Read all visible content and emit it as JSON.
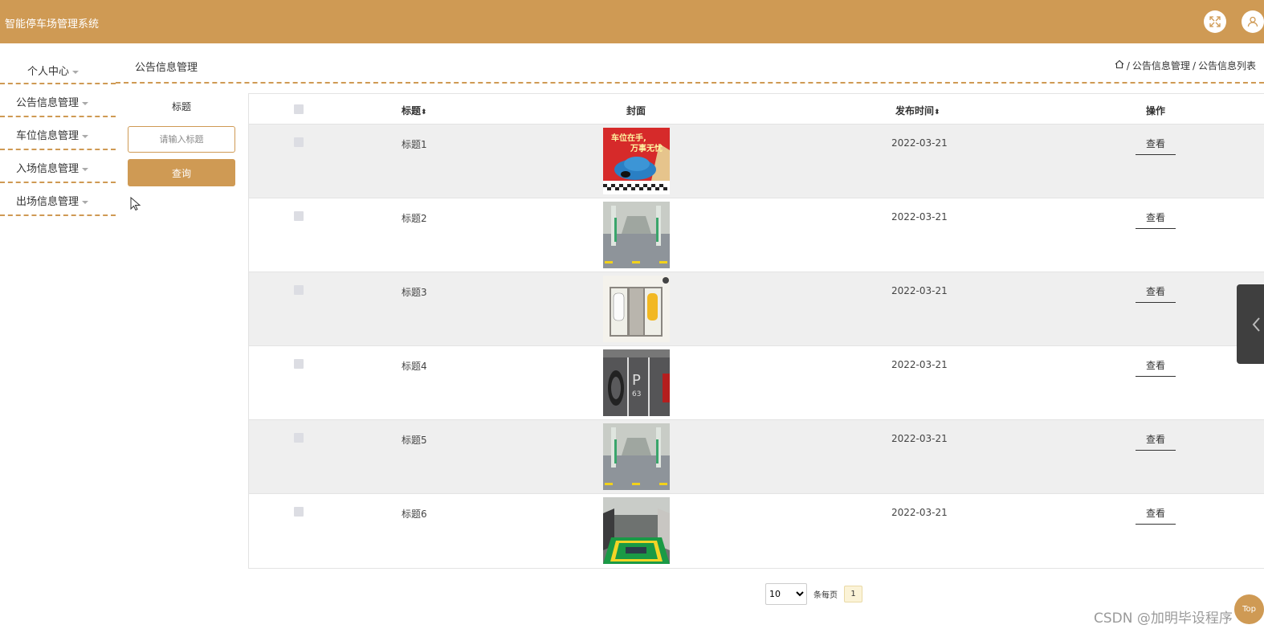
{
  "header": {
    "app_title": "智能停车场管理系统",
    "icons": [
      "fullscreen-icon",
      "user-icon"
    ]
  },
  "sidebar": {
    "items": [
      {
        "label": "个人中心"
      },
      {
        "label": "公告信息管理"
      },
      {
        "label": "车位信息管理"
      },
      {
        "label": "入场信息管理"
      },
      {
        "label": "出场信息管理"
      }
    ]
  },
  "page": {
    "title": "公告信息管理",
    "breadcrumb": [
      "公告信息管理",
      "公告信息列表"
    ]
  },
  "search": {
    "label": "标题",
    "placeholder": "请输入标题",
    "button_label": "查询"
  },
  "table": {
    "headers": {
      "title": "标题",
      "cover": "封面",
      "date": "发布时间",
      "action": "操作"
    },
    "rows": [
      {
        "title": "标题1",
        "date": "2022-03-21",
        "action": "查看"
      },
      {
        "title": "标题2",
        "date": "2022-03-21",
        "action": "查看"
      },
      {
        "title": "标题3",
        "date": "2022-03-21",
        "action": "查看"
      },
      {
        "title": "标题4",
        "date": "2022-03-21",
        "action": "查看"
      },
      {
        "title": "标题5",
        "date": "2022-03-21",
        "action": "查看"
      },
      {
        "title": "标题6",
        "date": "2022-03-21",
        "action": "查看"
      }
    ],
    "cover_1_text": [
      "车位在手,",
      "万事无忧"
    ]
  },
  "pagination": {
    "page_size": "10",
    "page_size_options": [
      "10"
    ],
    "per_page_label": "条每页",
    "current_page": "1"
  },
  "float": {
    "top_label": "Top"
  },
  "watermark": "CSDN @加明毕设程序",
  "colors": {
    "accent": "#cf9a54",
    "row_alt": "#efefef"
  }
}
